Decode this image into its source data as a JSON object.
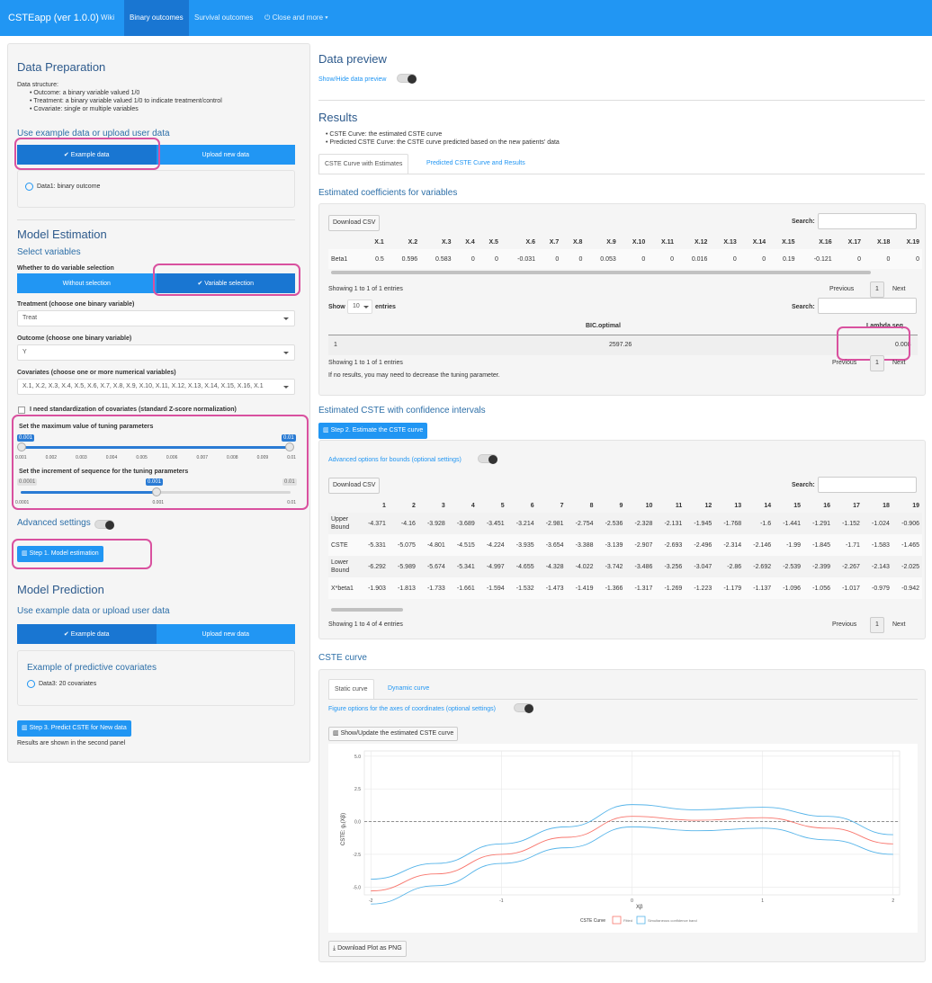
{
  "navbar": {
    "brand": "CSTEapp (ver 1.0.0)",
    "items": [
      "Wiki",
      "Binary outcomes",
      "Survival outcomes",
      "Close and more"
    ]
  },
  "prep": {
    "title": "Data Preparation",
    "structure_label": "Data structure:",
    "bullets": [
      "Outcome: a binary variable valued 1/0",
      "Treatment: a binary variable valued 1/0 to indicate treatment/control",
      "Covariate: single or multiple variables"
    ],
    "use_example": "Use example data or upload user data",
    "example_btn": "Example data",
    "upload_btn": "Upload new data",
    "dataset_radio": "Data1: binary outcome"
  },
  "estimation": {
    "title": "Model Estimation",
    "select_vars": "Select variables",
    "varsel_label": "Whether to do variable selection",
    "without_btn": "Without selection",
    "with_btn": "Variable selection",
    "treatment_label": "Treatment (choose one binary variable)",
    "treatment_value": "Treat",
    "outcome_label": "Outcome (choose one binary variable)",
    "outcome_value": "Y",
    "covariates_label": "Covariates (choose one or more numerical variables)",
    "covariates_value": "X.1, X.2, X.3, X.4, X.5, X.6, X.7, X.8, X.9, X.10, X.11, X.12, X.13, X.14, X.15, X.16, X.1",
    "standardize_label": "I need standardization of covariates (standard Z-score normalization)",
    "max_label": "Set the maximum value of tuning parameters",
    "max_from": "0.001",
    "max_to": "0.01",
    "max_ticks": [
      "0.001",
      "0.002",
      "0.003",
      "0.004",
      "0.005",
      "0.006",
      "0.007",
      "0.008",
      "0.009",
      "0.01"
    ],
    "inc_label": "Set the increment of sequence for the tuning parameters",
    "inc_min": "0.0001",
    "inc_value": "0.001",
    "inc_max": "0.01",
    "inc_ticks": [
      "0.0001",
      "0.001",
      "0.01"
    ],
    "advanced": "Advanced settings",
    "step1": "Step 1. Model estimation"
  },
  "prediction": {
    "title": "Model Prediction",
    "use_example": "Use example data or upload user data",
    "example_btn": "Example data",
    "upload_btn": "Upload new data",
    "example_title": "Example of predictive covariates",
    "dataset_radio": "Data3: 20 covariates",
    "step3": "Step 3. Predict CSTE for New data",
    "note": "Results are shown in the second panel"
  },
  "main": {
    "preview_title": "Data preview",
    "preview_toggle": "Show/Hide data preview",
    "results_title": "Results",
    "results_bullets": [
      "CSTE Curve: the estimated CSTE curve",
      "Predicted CSTE Curve: the CSTE curve predicted based on the new patients' data"
    ],
    "tabs": [
      "CSTE Curve with Estimates",
      "Predicted CSTE Curve and Results"
    ],
    "coef_title": "Estimated coefficients for variables",
    "download_csv": "Download CSV",
    "search": "Search:",
    "coef_headers": [
      "X.1",
      "X.2",
      "X.3",
      "X.4",
      "X.5",
      "X.6",
      "X.7",
      "X.8",
      "X.9",
      "X.10",
      "X.11",
      "X.12",
      "X.13",
      "X.14",
      "X.15",
      "X.16",
      "X.17",
      "X.18",
      "X.19"
    ],
    "coef_row_label": "Beta1",
    "coef_values": [
      "0.5",
      "0.596",
      "0.583",
      "0",
      "0",
      "-0.031",
      "0",
      "0",
      "0.053",
      "0",
      "0",
      "0.016",
      "0",
      "0",
      "0.19",
      "-0.121",
      "0",
      "0",
      "0"
    ],
    "showing_1_1": "Showing 1 to 1 of 1 entries",
    "previous": "Previous",
    "page_1": "1",
    "next": "Next",
    "show": "Show",
    "show_n": "10",
    "entries": "entries",
    "bic_header": "BIC.optimal",
    "lambda_header": "Lambda.seq",
    "bic_row_index": "1",
    "bic_value": "2597.26",
    "lambda_value": "0.008",
    "tuning_note": "If no results, you may need to decrease the tuning parameter.",
    "ci_title": "Estimated CSTE with confidence intervals",
    "step2": "Step 2. Estimate the CSTE curve",
    "adv_bounds": "Advanced options for bounds (optional settings)",
    "ci_headers": [
      "1",
      "2",
      "3",
      "4",
      "5",
      "6",
      "7",
      "8",
      "9",
      "10",
      "11",
      "12",
      "13",
      "14",
      "15",
      "16",
      "17",
      "18",
      "19"
    ],
    "ci_rows": [
      {
        "label": "Upper Bound",
        "values": [
          "-4.371",
          "-4.16",
          "-3.928",
          "-3.689",
          "-3.451",
          "-3.214",
          "-2.981",
          "-2.754",
          "-2.536",
          "-2.328",
          "-2.131",
          "-1.945",
          "-1.768",
          "-1.6",
          "-1.441",
          "-1.291",
          "-1.152",
          "-1.024",
          "-0.906"
        ]
      },
      {
        "label": "CSTE",
        "values": [
          "-5.331",
          "-5.075",
          "-4.801",
          "-4.515",
          "-4.224",
          "-3.935",
          "-3.654",
          "-3.388",
          "-3.139",
          "-2.907",
          "-2.693",
          "-2.496",
          "-2.314",
          "-2.146",
          "-1.99",
          "-1.845",
          "-1.71",
          "-1.583",
          "-1.465"
        ]
      },
      {
        "label": "Lower Bound",
        "values": [
          "-6.292",
          "-5.989",
          "-5.674",
          "-5.341",
          "-4.997",
          "-4.655",
          "-4.328",
          "-4.022",
          "-3.742",
          "-3.486",
          "-3.256",
          "-3.047",
          "-2.86",
          "-2.692",
          "-2.539",
          "-2.399",
          "-2.267",
          "-2.143",
          "-2.025"
        ]
      },
      {
        "label": "X*beta1",
        "values": [
          "-1.903",
          "-1.813",
          "-1.733",
          "-1.661",
          "-1.594",
          "-1.532",
          "-1.473",
          "-1.419",
          "-1.366",
          "-1.317",
          "-1.269",
          "-1.223",
          "-1.179",
          "-1.137",
          "-1.096",
          "-1.056",
          "-1.017",
          "-0.979",
          "-0.942"
        ]
      }
    ],
    "showing_1_4": "Showing 1 to 4 of 4 entries",
    "curve_title": "CSTE curve",
    "curve_tabs": [
      "Static curve",
      "Dynamic curve"
    ],
    "fig_options": "Figure options for the axes of coordinates (optional settings)",
    "show_update": "Show/Update the estimated CSTE curve",
    "download_png": "Download Plot as PNG"
  },
  "chart_data": {
    "type": "line",
    "x": [
      -2,
      -1.5,
      -1,
      -0.5,
      0,
      0.5,
      1,
      1.5,
      2
    ],
    "series": [
      {
        "name": "Fitted",
        "values": [
          -5.3,
          -4.0,
          -2.5,
          -1.2,
          0.4,
          0.1,
          0.3,
          -0.5,
          -1.7
        ]
      },
      {
        "name": "Simultaneous confidence band",
        "values": [
          -4.4,
          -3.2,
          -1.7,
          -0.4,
          1.3,
          0.9,
          1.1,
          0.4,
          -1.0
        ]
      },
      {
        "name": "Simultaneous confidence band",
        "values": [
          -6.3,
          -4.9,
          -3.2,
          -2.0,
          -0.4,
          -0.7,
          -0.5,
          -1.4,
          -2.5
        ]
      }
    ],
    "y_ticks": [
      "5.0",
      "2.5",
      "0.0",
      "-2.5",
      "-5.0"
    ],
    "x_ticks": [
      "-2",
      "-1",
      "0",
      "1",
      "2"
    ],
    "ylim": [
      -5.6,
      5.4
    ],
    "xlim": [
      -2.05,
      2.05
    ],
    "xlabel": "Xβ",
    "ylabel": "CSTE: g₁(Xβ)",
    "legend_title": "CSTE Curve",
    "legend_fitted": "Fitted",
    "legend_band": "Simultaneous confidence band",
    "colors": {
      "fitted": "#f8766d",
      "band": "#56b4e9",
      "reference": "#555555"
    },
    "grid": true,
    "legend_position": "bottom"
  }
}
